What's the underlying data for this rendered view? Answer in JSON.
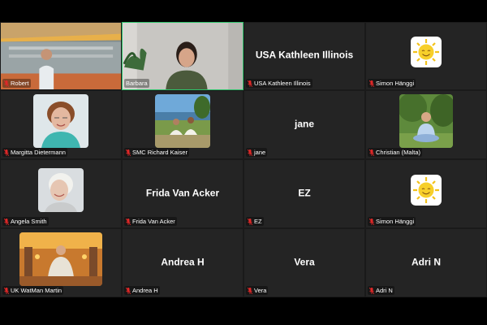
{
  "participants": [
    {
      "name": "Robert",
      "display": "video",
      "active": false
    },
    {
      "name": "Barbara",
      "display": "video",
      "active": true
    },
    {
      "name": "USA Kathleen Illinois",
      "big_name": "USA Kathleen Illinois",
      "display": "name"
    },
    {
      "name": "Simon Hänggi",
      "display": "avatar-sun"
    },
    {
      "name": "Margitta Dietermann",
      "display": "avatar-photo"
    },
    {
      "name": "SMC Richard Kaiser",
      "display": "avatar-photo"
    },
    {
      "name": "jane",
      "big_name": "jane",
      "display": "name"
    },
    {
      "name": "Christian (Malta)",
      "display": "avatar-photo"
    },
    {
      "name": "Angela Smith",
      "display": "avatar-photo"
    },
    {
      "name": "Frida Van Acker",
      "big_name": "Frida Van Acker",
      "display": "name"
    },
    {
      "name": "EZ",
      "big_name": "EZ",
      "display": "name"
    },
    {
      "name": "Simon Hänggi",
      "display": "avatar-sun"
    },
    {
      "name": "UK WatMan Martin",
      "display": "avatar-photo"
    },
    {
      "name": "Andrea H",
      "big_name": "Andrea H",
      "display": "name"
    },
    {
      "name": "Vera",
      "big_name": "Vera",
      "display": "name"
    },
    {
      "name": "Adri N",
      "big_name": "Adri N",
      "display": "name"
    }
  ],
  "colors": {
    "background": "#1a1a1a",
    "tile": "#242424",
    "active_speaker_border": "#2dc46b",
    "muted_icon": "#e02828"
  },
  "icons": {
    "muted": "mic-muted-icon"
  }
}
